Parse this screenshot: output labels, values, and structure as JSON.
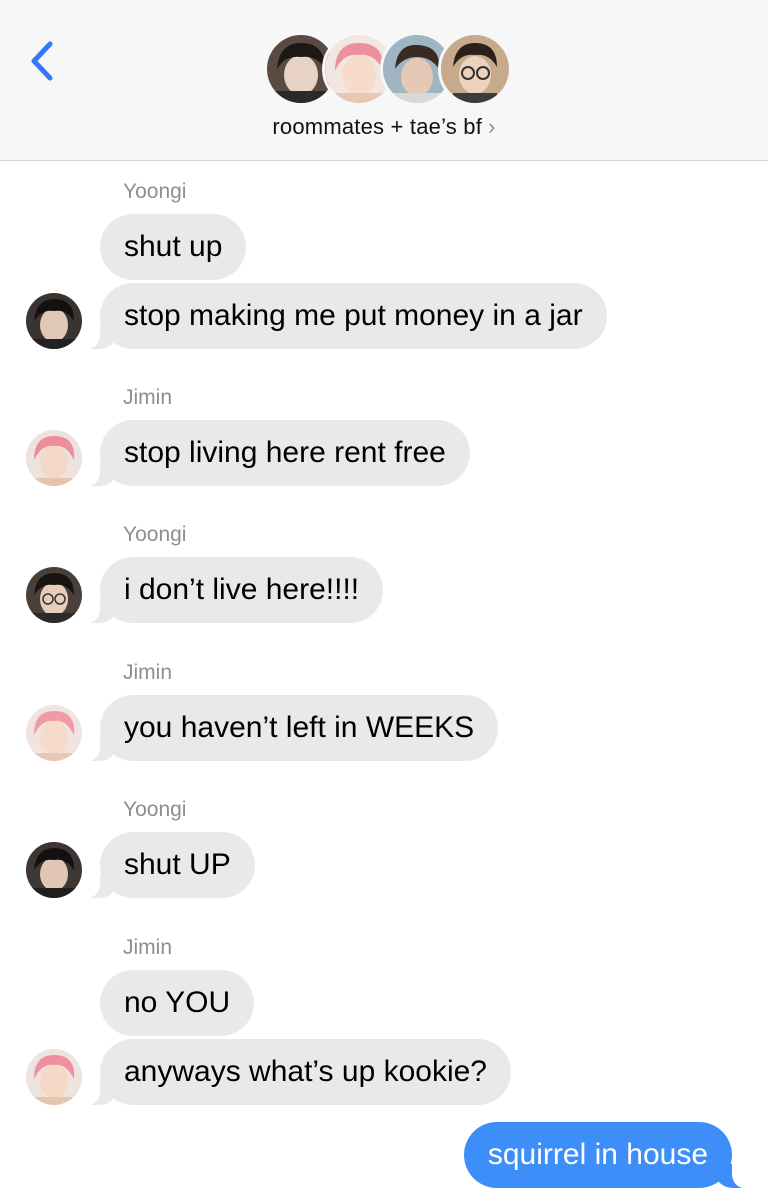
{
  "header": {
    "back_icon": "chevron-left-icon",
    "title": "roommates + tae’s bf",
    "title_chevron": "›",
    "accent_color": "#3478f6"
  },
  "participants": [
    {
      "avatar": "avatar-dark-hair"
    },
    {
      "avatar": "avatar-pink-hair"
    },
    {
      "avatar": "avatar-brown-hair"
    },
    {
      "avatar": "avatar-glasses"
    }
  ],
  "messages": [
    {
      "sender": "Yoongi",
      "text": "shut up",
      "direction": "incoming"
    },
    {
      "text": "stop making me put money in a jar",
      "direction": "incoming"
    },
    {
      "sender": "Jimin",
      "text": "stop living here rent free",
      "direction": "incoming"
    },
    {
      "sender": "Yoongi",
      "text": "i don’t live here!!!!",
      "direction": "incoming"
    },
    {
      "sender": "Jimin",
      "text": "you haven’t left in WEEKS",
      "direction": "incoming"
    },
    {
      "sender": "Yoongi",
      "text": "shut UP",
      "direction": "incoming"
    },
    {
      "sender": "Jimin",
      "text": "no YOU",
      "direction": "incoming"
    },
    {
      "text": "anyways what’s up kookie?",
      "direction": "incoming"
    },
    {
      "text": "squirrel in house",
      "direction": "outgoing"
    }
  ],
  "colors": {
    "incoming_bubble": "#e9e9eb",
    "outgoing_bubble": "#3d8ef8",
    "sender_label": "#8e8e93"
  }
}
